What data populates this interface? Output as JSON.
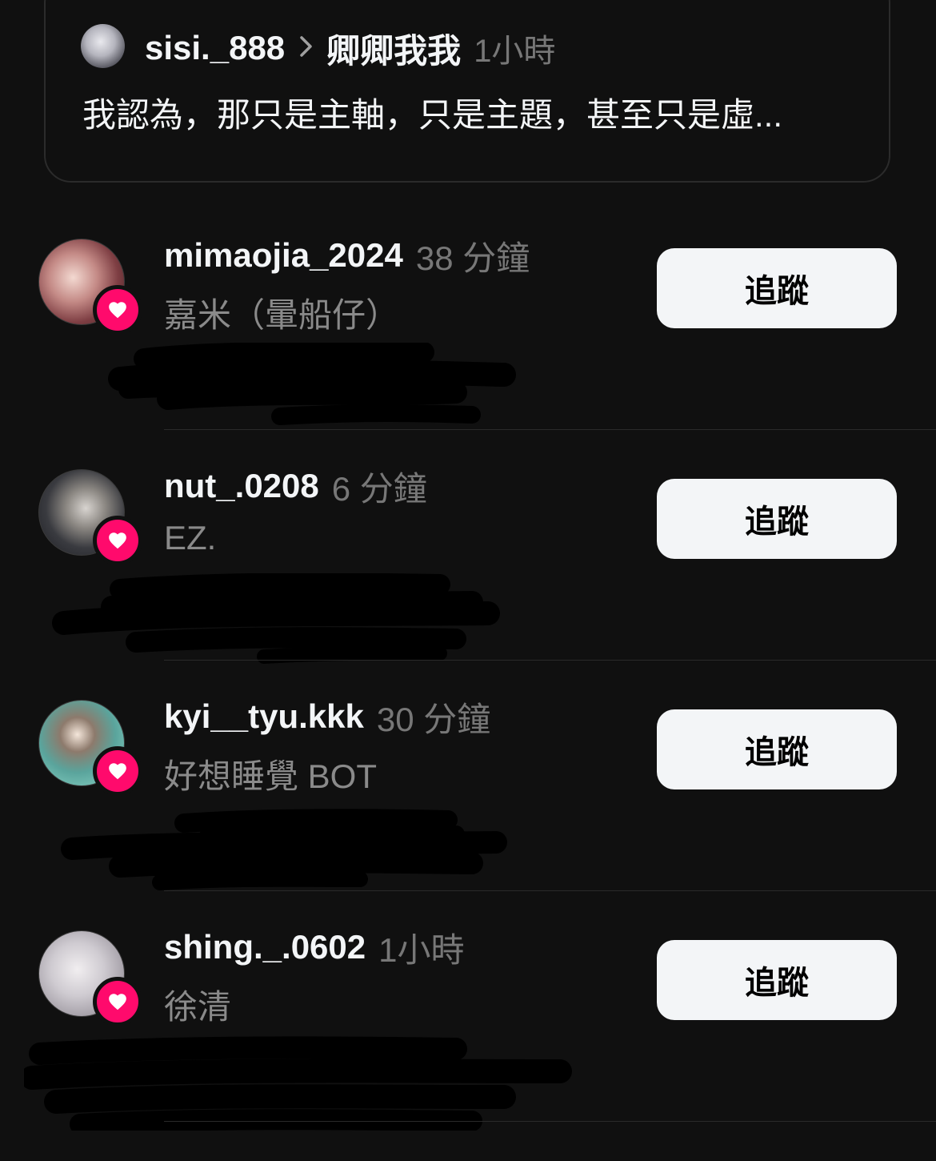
{
  "quote": {
    "username": "sisi._888",
    "target": "卿卿我我",
    "time": "1小時",
    "text": "我認為，那只是主軸，只是主題，甚至只是虛..."
  },
  "rows": [
    {
      "username": "mimaojia_2024",
      "time": "38 分鐘",
      "display_name": "嘉米（暈船仔）",
      "follow_label": "追蹤"
    },
    {
      "username": "nut_.0208",
      "time": "6 分鐘",
      "display_name": "EZ.",
      "follow_label": "追蹤"
    },
    {
      "username": "kyi__tyu.kkk",
      "time": "30 分鐘",
      "display_name": "好想睡覺 BOT",
      "follow_label": "追蹤"
    },
    {
      "username": "shing._.0602",
      "time": "1小時",
      "display_name": "徐清",
      "follow_label": "追蹤"
    }
  ],
  "colors": {
    "background": "#101010",
    "heart_badge": "#ff0a6c",
    "follow_button": "#f3f5f7"
  },
  "icons": {
    "chevron": "chevron-right-icon",
    "badge": "heart-icon"
  }
}
